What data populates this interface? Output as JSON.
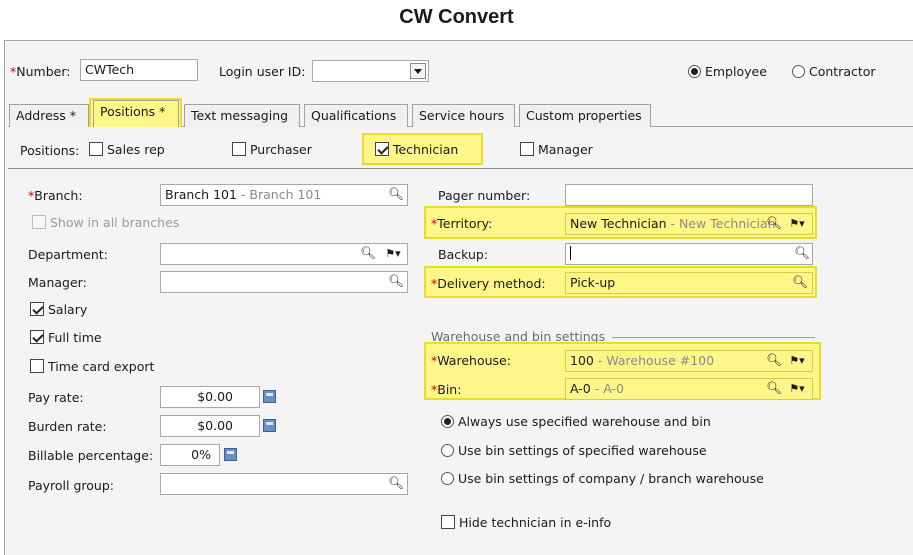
{
  "window": {
    "title": "CW Convert"
  },
  "header": {
    "number_label": "Number:",
    "number_value": "CWTech",
    "login_label": "Login user ID:",
    "login_value": "",
    "type_options": [
      {
        "label": "Employee",
        "selected": true
      },
      {
        "label": "Contractor",
        "selected": false
      }
    ]
  },
  "tabs": [
    {
      "label": "Address *",
      "active": false
    },
    {
      "label": "Positions *",
      "active": true
    },
    {
      "label": "Text messaging",
      "active": false
    },
    {
      "label": "Qualifications",
      "active": false
    },
    {
      "label": "Service hours",
      "active": false
    },
    {
      "label": "Custom properties",
      "active": false
    }
  ],
  "positions": {
    "label": "Positions:",
    "items": [
      {
        "label": "Sales rep",
        "checked": false
      },
      {
        "label": "Purchaser",
        "checked": false
      },
      {
        "label": "Technician",
        "checked": true
      },
      {
        "label": "Manager",
        "checked": false
      }
    ]
  },
  "left": {
    "branch_label": "Branch:",
    "branch_value": "Branch 101",
    "branch_hint": " - Branch 101",
    "show_all_label": "Show in all branches",
    "department_label": "Department:",
    "manager_label": "Manager:",
    "salary_label": "Salary",
    "fulltime_label": "Full time",
    "timecard_label": "Time card export",
    "payrate_label": "Pay rate:",
    "payrate_value": "$0.00",
    "burden_label": "Burden rate:",
    "burden_value": "$0.00",
    "billable_label": "Billable percentage:",
    "billable_value": "0%",
    "payroll_label": "Payroll group:"
  },
  "right": {
    "pager_label": "Pager number:",
    "territory_label": "Territory:",
    "territory_value": "New Technician",
    "territory_hint": " - New Technician",
    "backup_label": "Backup:",
    "delivery_label": "Delivery method:",
    "delivery_value": "Pick-up",
    "wh_section_label": "Warehouse and bin settings",
    "warehouse_label": "Warehouse:",
    "warehouse_value": "100",
    "warehouse_hint": " - Warehouse #100",
    "bin_label": "Bin:",
    "bin_value": "A-0",
    "bin_hint": " - A-0",
    "wh_options": [
      {
        "label": "Always use specified warehouse and bin",
        "selected": true
      },
      {
        "label": "Use bin settings of specified warehouse",
        "selected": false
      },
      {
        "label": "Use bin settings of company / branch warehouse",
        "selected": false
      }
    ],
    "hide_tech_label": "Hide technician in e-info"
  },
  "colors": {
    "highlight": "#fff68a",
    "required": "#d00000"
  }
}
